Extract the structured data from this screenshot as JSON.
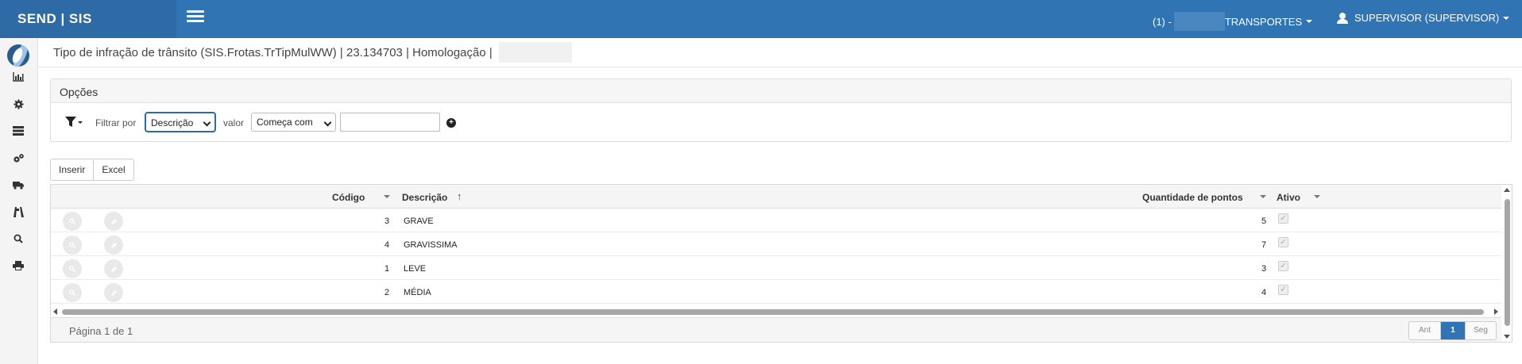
{
  "app": {
    "brand": "SEND | SIS",
    "company_prefix": "(1) -",
    "company_suffix": "TRANSPORTES",
    "user_label": "SUPERVISOR (SUPERVISOR)"
  },
  "sidebar": {
    "items": [
      {
        "icon": "bar-chart-icon"
      },
      {
        "icon": "gear-icon"
      },
      {
        "icon": "server-icon"
      },
      {
        "icon": "gears-icon"
      },
      {
        "icon": "truck-icon"
      },
      {
        "icon": "road-icon"
      },
      {
        "icon": "search-icon"
      },
      {
        "icon": "print-icon"
      }
    ]
  },
  "page": {
    "title": "Tipo de infração de trânsito (SIS.Frotas.TrTipMulWW) | 23.134703 | Homologação |"
  },
  "options": {
    "heading": "Opções",
    "filter_label": "Filtrar por",
    "filter_field_value": "Descrição",
    "value_label": "valor",
    "operator_value": "Começa com",
    "input_value": ""
  },
  "toolbar": {
    "insert_label": "Inserir",
    "excel_label": "Excel"
  },
  "grid": {
    "columns": {
      "codigo": "Código",
      "descricao": "Descrição",
      "pontos": "Quantidade de pontos",
      "ativo": "Ativo"
    },
    "rows": [
      {
        "codigo": "3",
        "descricao": "GRAVE",
        "pontos": "5",
        "ativo": true
      },
      {
        "codigo": "4",
        "descricao": "GRAVISSIMA",
        "pontos": "7",
        "ativo": true
      },
      {
        "codigo": "1",
        "descricao": "LEVE",
        "pontos": "3",
        "ativo": true
      },
      {
        "codigo": "2",
        "descricao": "MÉDIA",
        "pontos": "4",
        "ativo": true
      }
    ],
    "pager": {
      "info": "Página 1 de 1",
      "prev": "Ant",
      "current": "1",
      "next": "Seg"
    }
  },
  "colors": {
    "topbar": "#3174b4",
    "brand_bg": "#2d6aa6",
    "active_page": "#3174b4"
  }
}
